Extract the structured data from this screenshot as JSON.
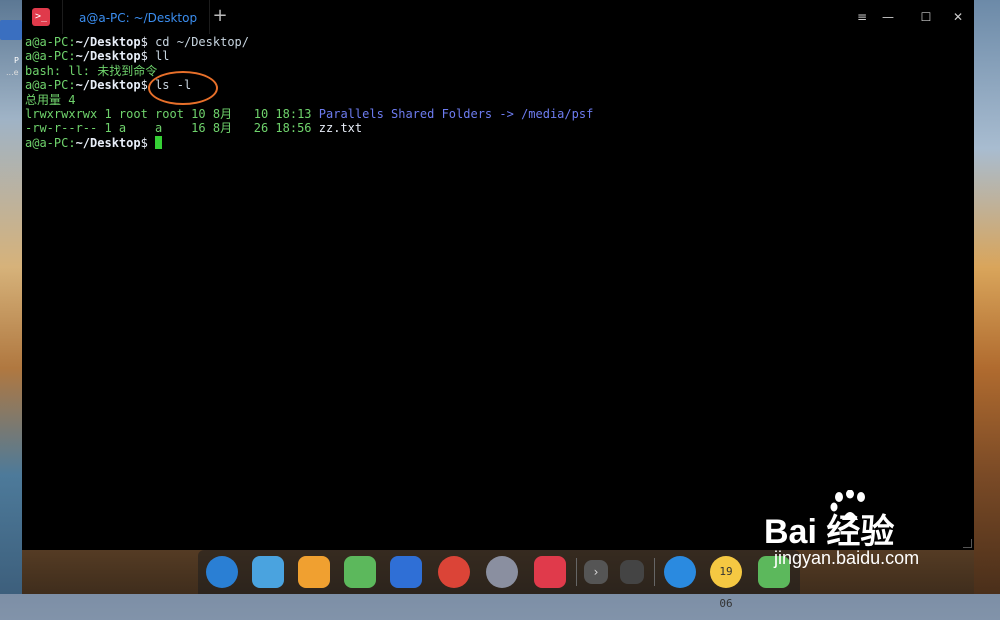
{
  "window": {
    "tab_title": "a@a-PC: ~/Desktop",
    "app_icon_glyph": ">_",
    "add_tab_glyph": "+",
    "controls": {
      "menu": "≡",
      "min": "—",
      "max": "☐",
      "close": "✕"
    }
  },
  "terminal": {
    "prompt_user": "a@a-PC",
    "prompt_sep": ":",
    "prompt_path": "~/Desktop",
    "prompt_dollar": "$",
    "lines": [
      {
        "kind": "prompt",
        "cmd": " cd ~/Desktop/"
      },
      {
        "kind": "prompt",
        "cmd": " ll"
      },
      {
        "kind": "output",
        "text": "bash: ll: 未找到命令"
      },
      {
        "kind": "prompt",
        "cmd": " ls -l"
      },
      {
        "kind": "output",
        "text": "总用量 4"
      },
      {
        "kind": "listing",
        "meta": "lrwxrwxrwx 1 root root 10 8月   10 18:13 ",
        "name": "Parallels Shared Folders",
        "arrow": " -> ",
        "target": "/media/psf"
      },
      {
        "kind": "listing",
        "meta": "-rw-r--r-- 1 a    a    16 8月   26 18:56 ",
        "name": "zz.txt"
      },
      {
        "kind": "prompt",
        "cmd": " "
      }
    ]
  },
  "colors": {
    "prompt": "#6fd36c",
    "path": "#e8eef8",
    "link": "#6d7cf0",
    "annotation": "#e8702a",
    "tab_text": "#3b8ef0"
  },
  "dock": {
    "items": [
      {
        "name": "launcher-icon",
        "color": "#2a7fd4"
      },
      {
        "name": "file-manager-icon",
        "color": "#4aa3df"
      },
      {
        "name": "app-store-icon",
        "color": "#f0a030"
      },
      {
        "name": "music-icon",
        "color": "#5cb85c"
      },
      {
        "name": "video-icon",
        "color": "#2f6fd6"
      },
      {
        "name": "chrome-icon",
        "color": "#db4437"
      },
      {
        "name": "settings-icon",
        "color": "#8a8fa0"
      },
      {
        "name": "terminal-icon",
        "color": "#e03a4b"
      },
      {
        "name": "show-more-icon",
        "color": "#555"
      },
      {
        "name": "keyboard-icon",
        "color": "#444"
      },
      {
        "name": "power-icon",
        "color": "#2a8ae0"
      },
      {
        "name": "clock-icon",
        "color": "#f5c842"
      },
      {
        "name": "trash-icon",
        "color": "#5cb85c"
      }
    ],
    "clock_text": "19 06"
  },
  "desktop": {
    "icon_label": "P",
    "icon_label2": "...e"
  },
  "watermark": {
    "main": "Bai  经验",
    "sub": "jingyan.baidu.com"
  }
}
